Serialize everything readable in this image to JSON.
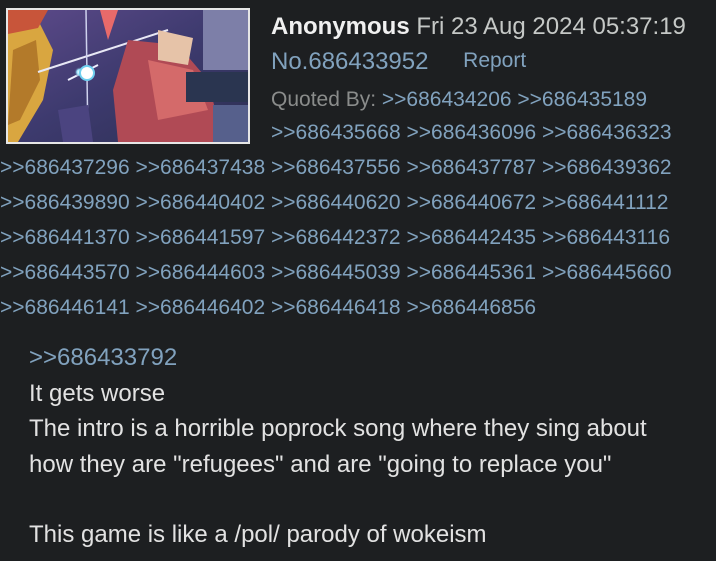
{
  "post": {
    "name": "Anonymous",
    "date": "Fri 23 Aug 2024 05:37:19",
    "number": "No.686433952",
    "report_label": "Report",
    "quoted_by_label": "Quoted By:",
    "backlinks": [
      ">>686434206",
      ">>686435189",
      ">>686435668",
      ">>686436096",
      ">>686436323",
      ">>686437296",
      ">>686437438",
      ">>686437556",
      ">>686437787",
      ">>686439362",
      ">>686439890",
      ">>686440402",
      ">>686440620",
      ">>686440672",
      ">>686441112",
      ">>686441370",
      ">>686441597",
      ">>686442372",
      ">>686442435",
      ">>686443116",
      ">>686443570",
      ">>686444603",
      ">>686445039",
      ">>686445361",
      ">>686445660",
      ">>686446141",
      ">>686446402",
      ">>686446418",
      ">>686446856"
    ],
    "body": {
      "quote_link": ">>686433792",
      "lines": [
        "It gets worse",
        "The intro is a horrible poprock song where they sing about",
        "how they are \"refugees\" and are \"going to replace you\"",
        "This game is like a /pol/ parody of wokeism"
      ]
    }
  },
  "colors": {
    "background": "#1d1f21",
    "link": "#81a2be",
    "text": "#c5c8c6",
    "name": "#f0f0f0"
  },
  "thumbnail": {
    "icon": "post-image-thumbnail"
  }
}
